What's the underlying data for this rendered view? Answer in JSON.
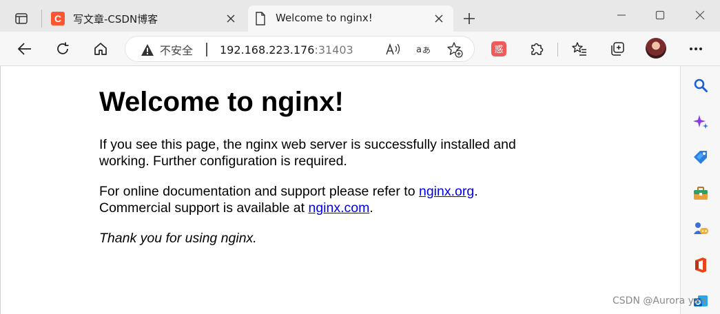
{
  "tabs": [
    {
      "title": "写文章-CSDN博客",
      "active": false,
      "favicon": "csdn-logo-icon",
      "favicon_letter": "C",
      "favicon_color": "#fc5531"
    },
    {
      "title": "Welcome to nginx!",
      "active": true,
      "favicon": "page-icon"
    }
  ],
  "toolbar": {
    "security_label": "不安全",
    "url_host": "192.168.223.176",
    "url_port": ":31403"
  },
  "extension": {
    "label": "惑",
    "color": "#f05a5a"
  },
  "page": {
    "heading": "Welcome to nginx!",
    "p1": "If you see this page, the nginx web server is successfully installed and working. Further configuration is required.",
    "p2_text1": "For online documentation and support please refer to ",
    "p2_link1": "nginx.org",
    "p2_text2": ".",
    "p2_text3": "Commercial support is available at ",
    "p2_link2": "nginx.com",
    "p2_text4": ".",
    "p3": "Thank you for using nginx.",
    "link_color": "#0000ee"
  },
  "sidebar": {
    "items": [
      "search-icon",
      "copilot-sparkle-icon",
      "shopping-tag-icon",
      "tools-briefcase-icon",
      "games-icon",
      "office-icon",
      "outlook-icon"
    ]
  },
  "watermark": "CSDN @Aurora yan"
}
